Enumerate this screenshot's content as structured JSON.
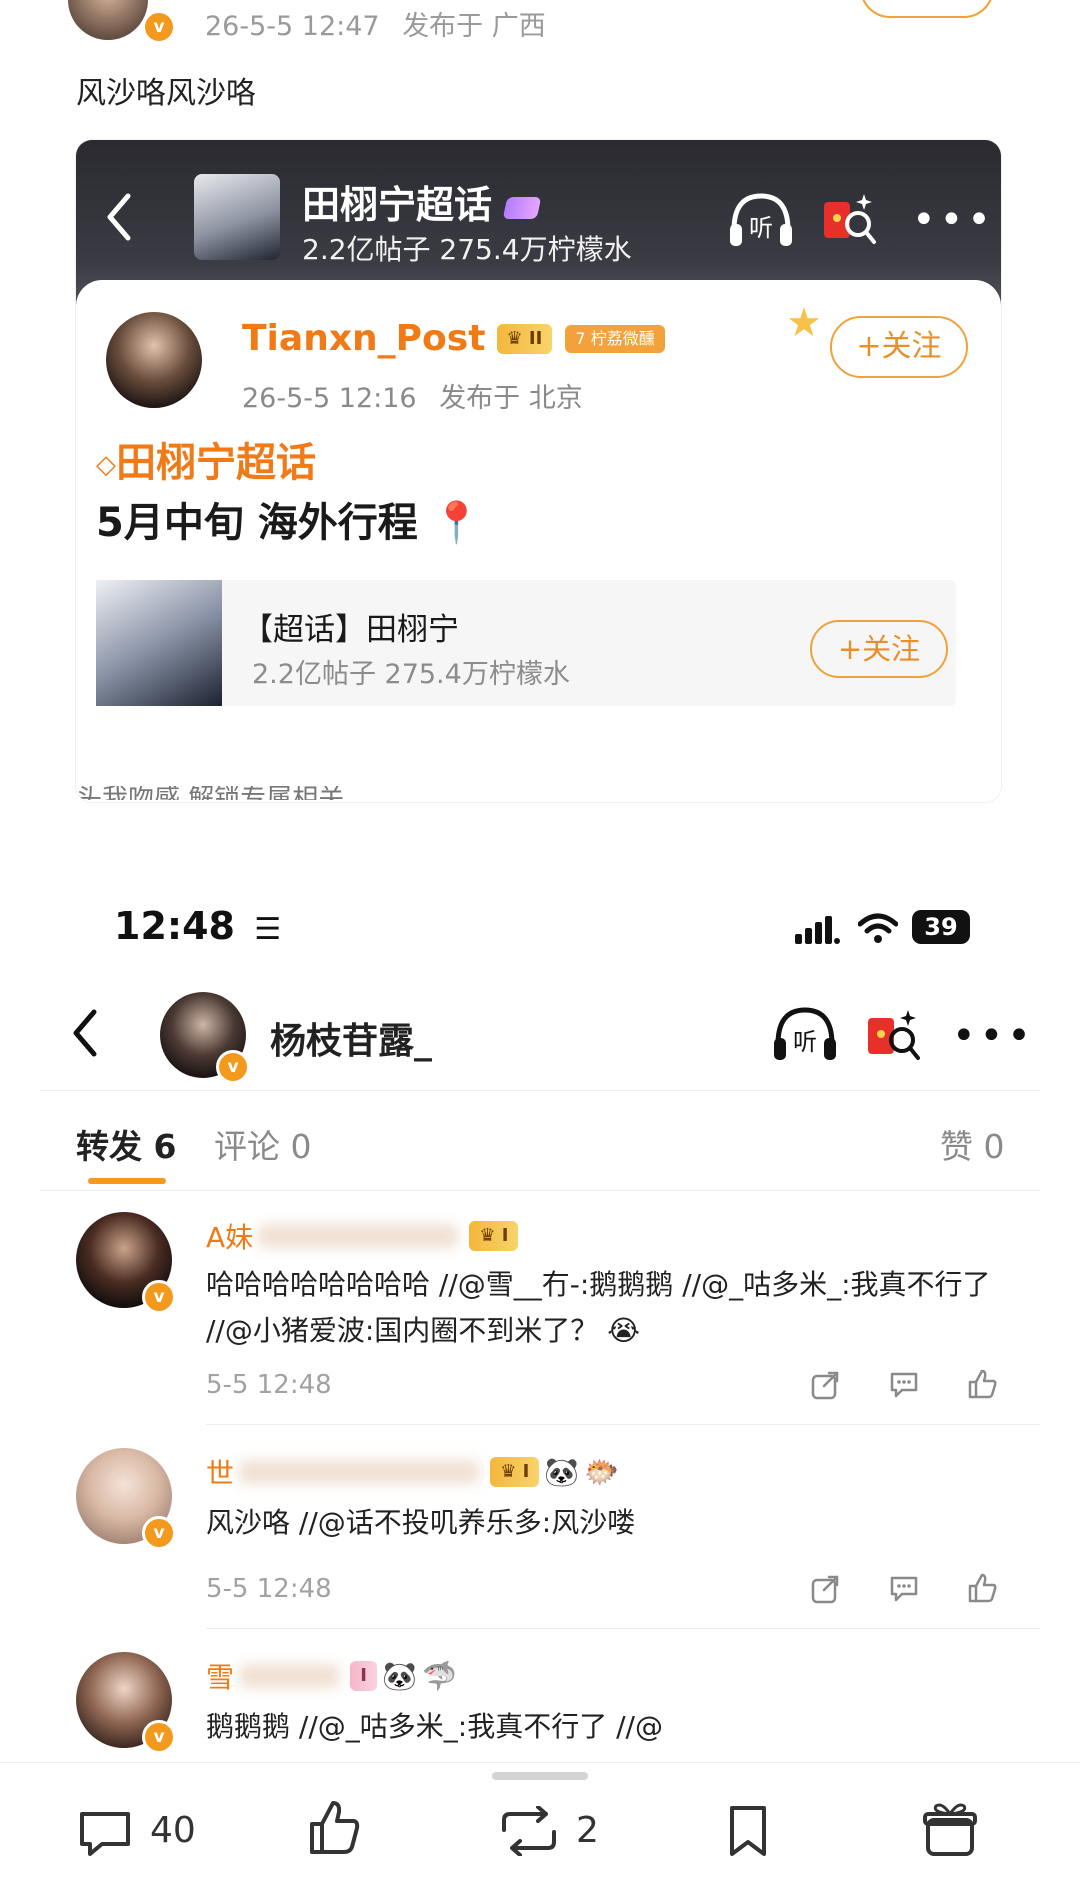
{
  "top_post": {
    "time": "26-5-5 12:47",
    "location": "发布于 广西",
    "text": "风沙咯风沙咯"
  },
  "embedded": {
    "topic_title": "田栩宁超话",
    "topic_stats": "2.2亿帖子 275.4万柠檬水",
    "listen_label": "听",
    "author": "Tianxn_Post",
    "level_badge": "II",
    "rank_badge": "7 柠荔微醺",
    "post_time": "26-5-5 12:16",
    "post_location": "发布于 北京",
    "follow_label": "+关注",
    "hashtag": "田栩宁超话",
    "content": "5月中旬 海外行程",
    "card_title": "【超话】田栩宁",
    "card_stats": "2.2亿帖子 275.4万柠檬水",
    "card_follow": "+关注",
    "cut_text": "头我吻感   解锁专属相关"
  },
  "status_bar": {
    "time": "12:48",
    "battery": "39"
  },
  "header": {
    "username": "杨枝苷露_",
    "listen_label": "听"
  },
  "tabs": {
    "repost": "转发 6",
    "comment": "评论 0",
    "like": "赞 0"
  },
  "reposts": [
    {
      "name": "A妹",
      "badge": "I",
      "text": "哈哈哈哈哈哈哈哈 //@雪__冇-:鹅鹅鹅 //@_咕多米_:我真不行了 //@小猪爱波:国内圈不到米了？ 😭",
      "time": "5-5 12:48"
    },
    {
      "name": "世",
      "badge": "I",
      "text": "风沙咯 //@话不投叽养乐多:风沙喽",
      "time": "5-5 12:48"
    },
    {
      "name": "雪",
      "badge": "I",
      "text": "鹅鹅鹅 //@_咕多米_:我真不行了 //@",
      "time": ""
    }
  ],
  "bottom_bar": {
    "comments": "40",
    "reposts": "2"
  },
  "colors": {
    "accent": "#f39a1e",
    "text_gray": "#9a9a9a",
    "header_dark": "#2f2f35"
  }
}
